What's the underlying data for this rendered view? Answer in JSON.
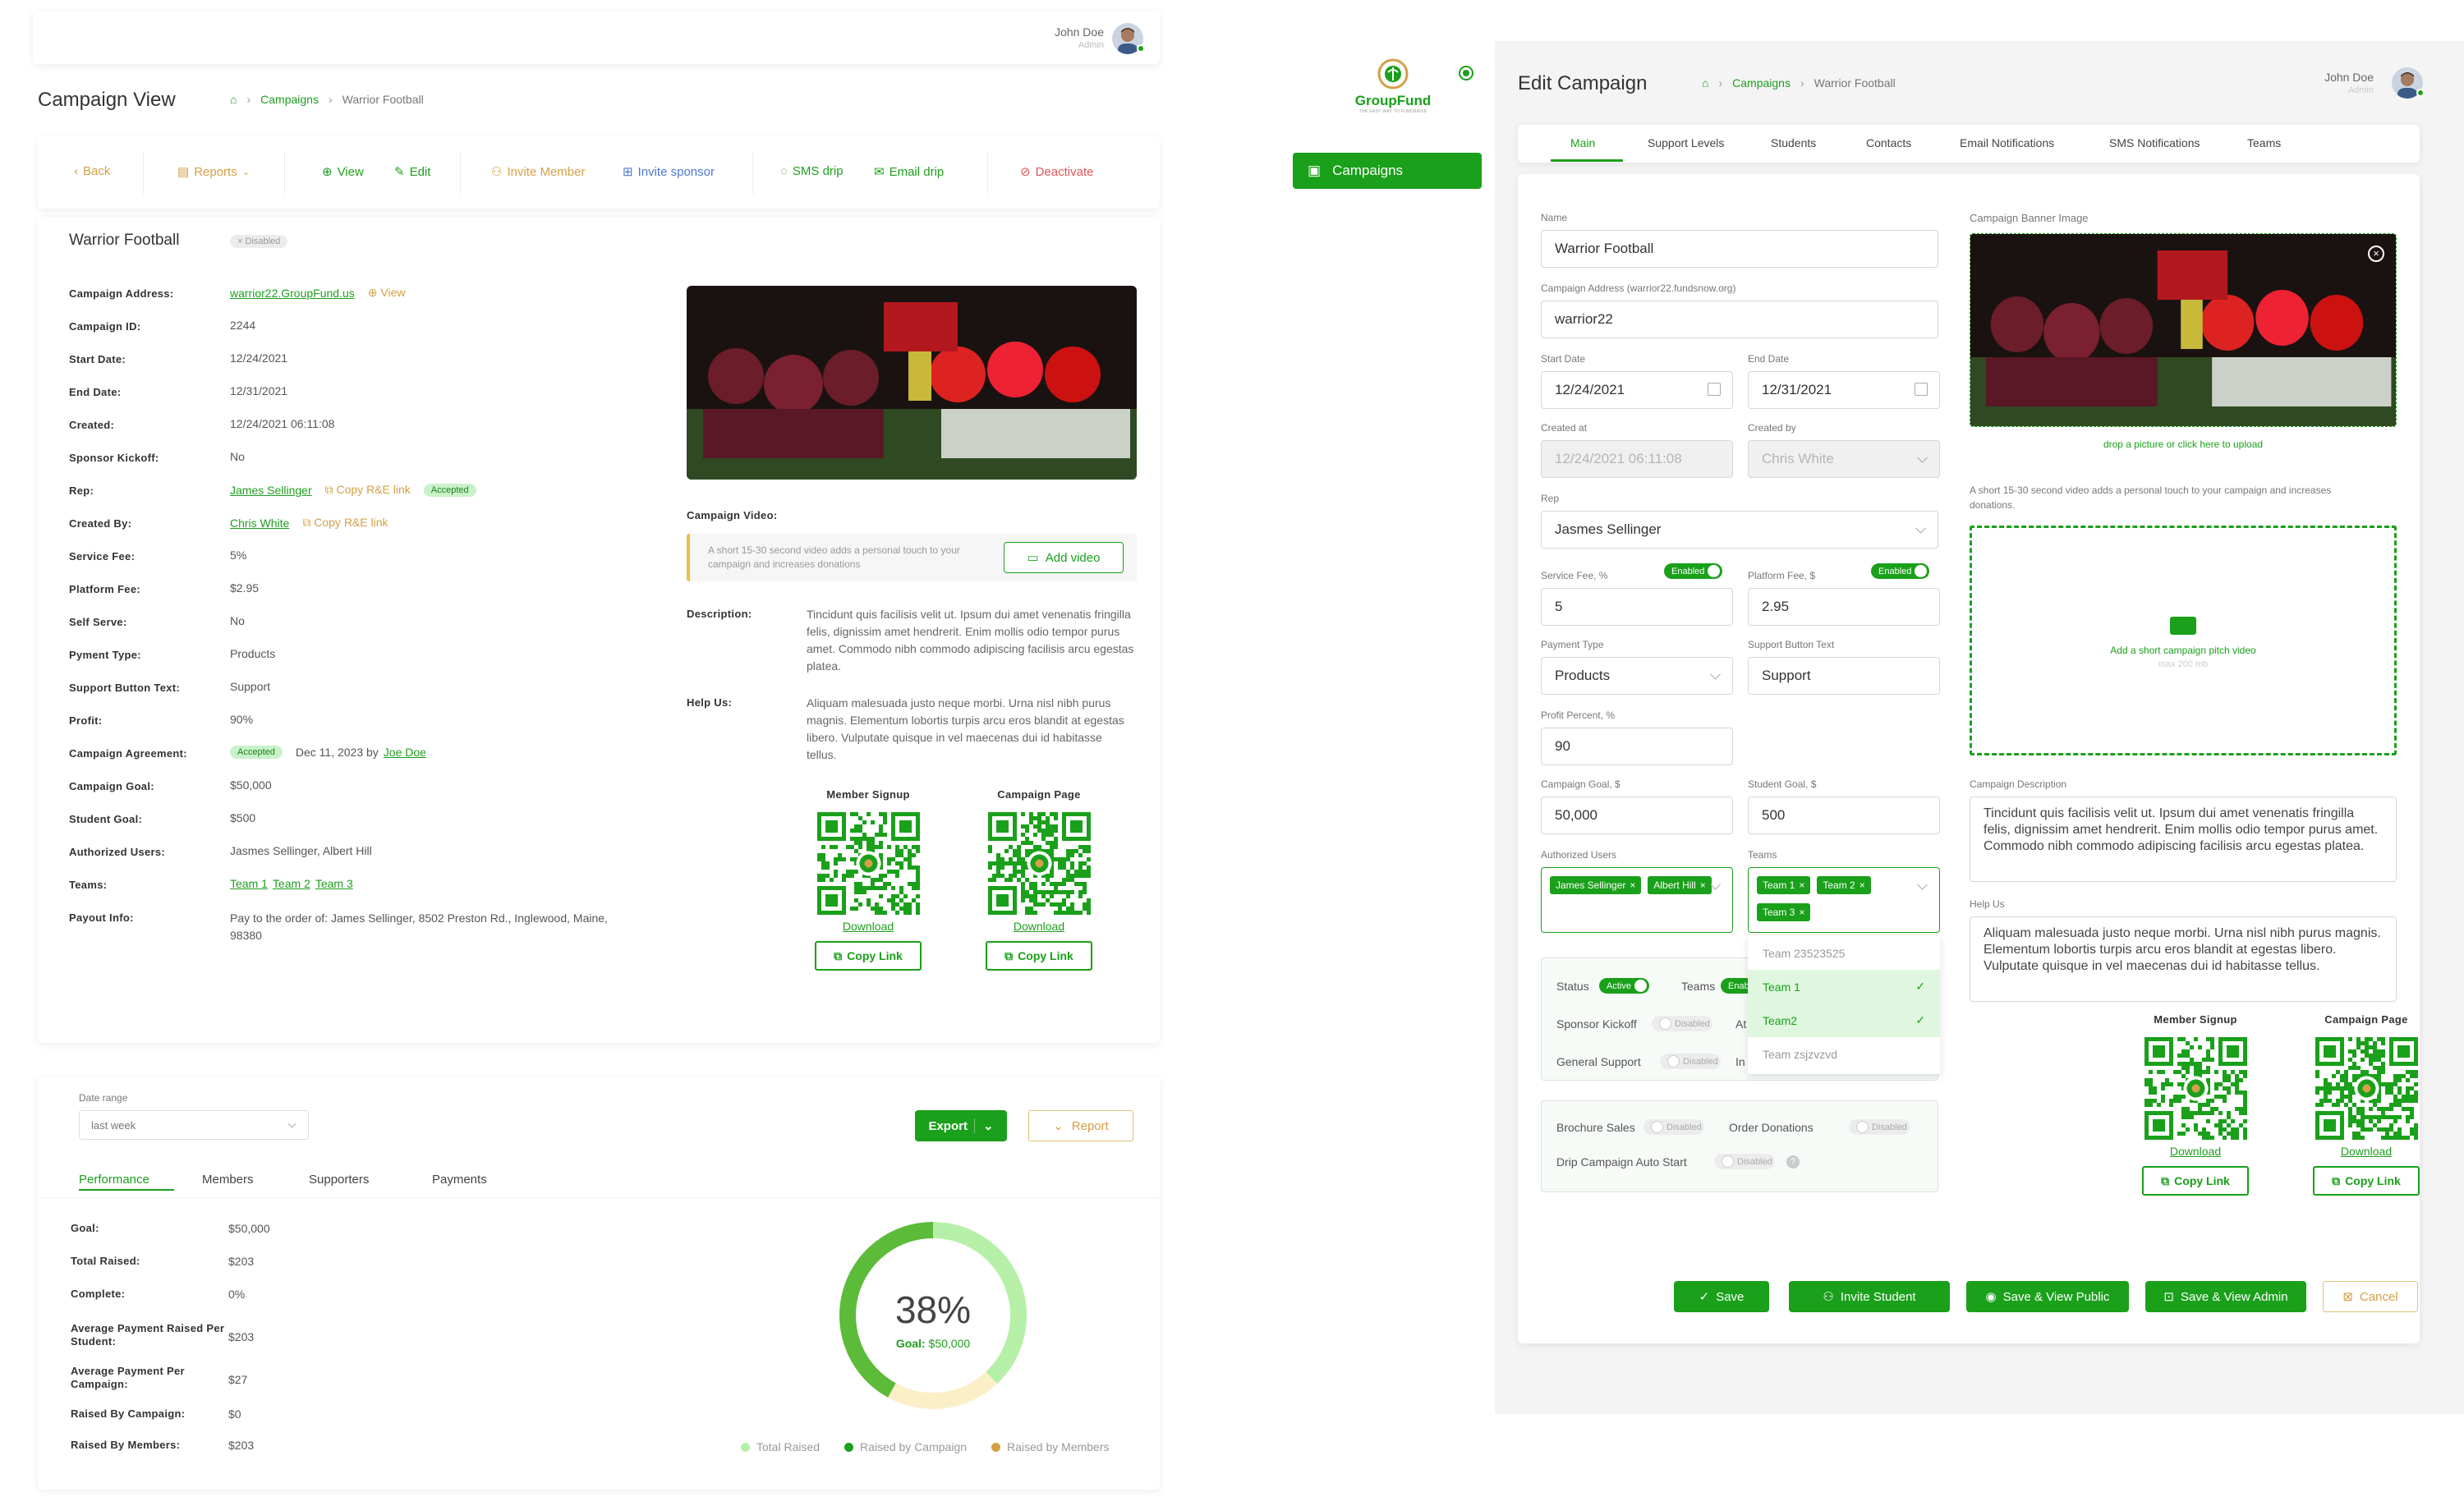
{
  "user": {
    "name": "John Doe",
    "role": "Admin"
  },
  "left": {
    "page_title": "Campaign View",
    "breadcrumb": {
      "campaigns": "Campaigns",
      "current": "Warrior Football"
    },
    "toolbar": {
      "back": "Back",
      "reports": "Reports",
      "view": "View",
      "edit": "Edit",
      "invite_member": "Invite Member",
      "invite_sponsor": "Invite sponsor",
      "sms_drip": "SMS drip",
      "email_drip": "Email drip",
      "deactivate": "Deactivate"
    },
    "campaign_name": "Warrior Football",
    "status_badge": "Disabled",
    "details": [
      {
        "label": "Campaign Address:",
        "value": "warrior22.GroupFund.us",
        "link": true,
        "extra": "View"
      },
      {
        "label": "Campaign ID:",
        "value": "2244"
      },
      {
        "label": "Start Date:",
        "value": "12/24/2021"
      },
      {
        "label": "End Date:",
        "value": "12/31/2021"
      },
      {
        "label": "Created:",
        "value": "12/24/2021 06:11:08"
      },
      {
        "label": "Sponsor Kickoff:",
        "value": "No"
      },
      {
        "label": "Rep:",
        "value": "James Sellinger",
        "link": true,
        "copy": "Copy R&E link",
        "badge": "Accepted"
      },
      {
        "label": "Created By:",
        "value": "Chris White",
        "link": true,
        "copy": "Copy R&E link"
      },
      {
        "label": "Service Fee:",
        "value": "5%"
      },
      {
        "label": "Platform Fee:",
        "value": "$2.95"
      },
      {
        "label": "Self Serve:",
        "value": "No"
      },
      {
        "label": "Pyment Type:",
        "value": "Products"
      },
      {
        "label": "Support Button Text:",
        "value": "Support"
      },
      {
        "label": "Profit:",
        "value": "90%"
      },
      {
        "label": "Campaign Agreement:",
        "badge": "Accepted",
        "value": "Dec 11, 2023 by",
        "by": "Joe Doe"
      },
      {
        "label": "Campaign Goal:",
        "value": "$50,000"
      },
      {
        "label": "Student Goal:",
        "value": "$500"
      },
      {
        "label": "Authorized Users:",
        "value": "Jasmes Sellinger, Albert Hill"
      },
      {
        "label": "Teams:",
        "teams": [
          "Team 1",
          "Team 2",
          "Team 3"
        ]
      },
      {
        "label": "Payout Info:",
        "value": "Pay to the order of: James Sellinger, 8502 Preston Rd., Inglewood, Maine, 98380"
      }
    ],
    "video_label": "Campaign Video:",
    "video_hint": "A short 15-30 second video adds a personal touch to your campaign and increases donations",
    "add_video": "Add video",
    "description_label": "Description:",
    "description": "Tincidunt quis facilisis velit ut. Ipsum dui amet venenatis fringilla felis, dignissim amet hendrerit. Enim mollis odio tempor purus amet. Commodo nibh commodo adipiscing facilisis arcu egestas platea.",
    "helpus_label": "Help Us:",
    "helpus": "Aliquam malesuada justo neque morbi. Urna nisl nibh purus magnis. Elementum lobortis turpis arcu eros blandit at egestas libero. Vulputate quisque in vel maecenas dui id habitasse tellus.",
    "qr": [
      {
        "title": "Member Signup",
        "download": "Download",
        "copy": "Copy Link"
      },
      {
        "title": "Campaign Page",
        "download": "Download",
        "copy": "Copy Link"
      }
    ],
    "date_range_label": "Date range",
    "date_range_value": "last week",
    "export": "Export",
    "report": "Report",
    "perf_tabs": [
      "Performance",
      "Members",
      "Supporters",
      "Payments"
    ],
    "stats": [
      {
        "label": "Goal:",
        "value": "$50,000"
      },
      {
        "label": "Total Raised:",
        "value": "$203"
      },
      {
        "label": "Complete:",
        "value": "0%"
      },
      {
        "label": "Average Payment Raised Per Student:",
        "value": "$203"
      },
      {
        "label": "Average Payment Per Campaign:",
        "value": "$27"
      },
      {
        "label": "Raised By Campaign:",
        "value": "$0"
      },
      {
        "label": "Raised By Members:",
        "value": "$203"
      }
    ],
    "donut": {
      "percent_text": "38%",
      "goal_label": "Goal:",
      "goal_value": "$50,000",
      "total_raised": 0.38,
      "by_campaign": 0.42,
      "by_members": 0.2
    },
    "legend": [
      "Total Raised",
      "Raised by Campaign",
      "Raised by Members"
    ]
  },
  "sidebar": {
    "logo": "GroupFund",
    "tagline": "THE EASY WAY TO FUNDRAISE",
    "nav": "Campaigns"
  },
  "right": {
    "page_title": "Edit Campaign",
    "breadcrumb": {
      "campaigns": "Campaigns",
      "current": "Warrior Football"
    },
    "tabs": [
      "Main",
      "Support Levels",
      "Students",
      "Contacts",
      "Email Notifications",
      "SMS Notifications",
      "Teams"
    ],
    "form": {
      "name_label": "Name",
      "name": "Warrior Football",
      "address_label": "Campaign Address (warrior22.fundsnow.org)",
      "address": "warrior22",
      "start_label": "Start Date",
      "start": "12/24/2021",
      "end_label": "End Date",
      "end": "12/31/2021",
      "created_at_label": "Created at",
      "created_at": "12/24/2021 06:11:08",
      "created_by_label": "Created by",
      "created_by": "Chris White",
      "rep_label": "Rep",
      "rep": "Jasmes Sellinger",
      "service_fee_label": "Service Fee, %",
      "service_fee": "5",
      "enabled": "Enabled",
      "platform_fee_label": "Platform Fee, $",
      "platform_fee": "2.95",
      "payment_type_label": "Payment Type",
      "payment_type": "Products",
      "support_text_label": "Support Button Text",
      "support_text": "Support",
      "profit_label": "Profit Percent, %",
      "profit": "90",
      "goal_label": "Campaign Goal, $",
      "goal": "50,000",
      "student_goal_label": "Student Goal, $",
      "student_goal": "500",
      "auth_users_label": "Authorized Users",
      "auth_users": [
        "James Sellinger",
        "Albert Hill"
      ],
      "teams_label": "Teams",
      "teams": [
        "Team 1",
        "Team 2",
        "Team 3"
      ],
      "team_options": [
        {
          "label": "Team 23523525",
          "checked": false
        },
        {
          "label": "Team 1",
          "checked": true
        },
        {
          "label": "Team2",
          "checked": true
        },
        {
          "label": "Team zsjzvzvd",
          "checked": false
        }
      ],
      "status_label": "Status",
      "status": "Active",
      "teams_toggle_label": "Teams",
      "teams_toggle": "Enabled",
      "sponsor_kickoff_label": "Sponsor Kickoff",
      "general_support_label": "General Support",
      "disabled": "Disabled",
      "at_label": "At",
      "in_label": "In",
      "brochure_label": "Brochure Sales",
      "order_label": "Order Donations",
      "drip_label": "Drip Campaign Auto Start"
    },
    "banner_label": "Campaign Banner Image",
    "banner_hint": "drop a picture or click here to upload",
    "video_hint": "A short 15-30 second video adds a personal touch to your campaign and increases donations.",
    "video_add": "Add a short campaign pitch video",
    "video_max": "max 200 mb",
    "desc_label": "Campaign Description",
    "desc": "Tincidunt quis facilisis velit ut. Ipsum dui amet venenatis fringilla felis, dignissim amet hendrerit. Enim mollis odio tempor purus amet. Commodo nibh commodo adipiscing facilisis arcu egestas platea.",
    "helpus_label": "Help Us",
    "helpus": "Aliquam malesuada justo neque morbi. Urna nisl nibh purus magnis. Elementum lobortis turpis arcu eros blandit at egestas libero. Vulputate quisque in vel maecenas dui id habitasse tellus.",
    "qr": [
      {
        "title": "Member Signup",
        "download": "Download",
        "copy": "Copy Link"
      },
      {
        "title": "Campaign Page",
        "download": "Download",
        "copy": "Copy Link"
      }
    ],
    "actions": {
      "save": "Save",
      "invite": "Invite Student",
      "save_public": "Save & View Public",
      "save_admin": "Save & View Admin",
      "cancel": "Cancel"
    }
  },
  "colors": {
    "green": "#1aa01a",
    "gold": "#d4a046",
    "blue": "#4a78d6",
    "red": "#e05555",
    "light_green": "#b6f0a8",
    "cream": "#fbefc8"
  }
}
